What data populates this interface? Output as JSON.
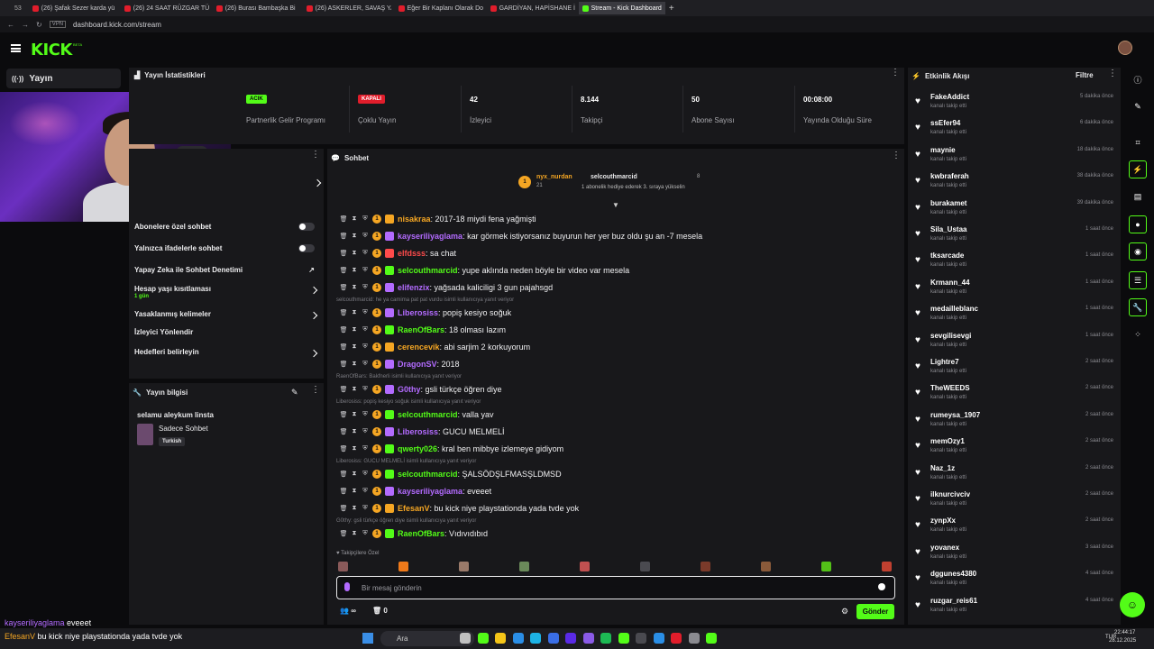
{
  "browser": {
    "tabs": [
      {
        "label": "(26) Şafak Sezer karda yü",
        "active": false
      },
      {
        "label": "(26) 24 SAAT RÜZGAR TÜ",
        "active": false
      },
      {
        "label": "(26) Burası Bambaşka Bi",
        "active": false
      },
      {
        "label": "(26) ASKERLER, SAVAŞ YA",
        "active": false
      },
      {
        "label": "Eğer Bir Kaplanı Olarak Do",
        "active": false
      },
      {
        "label": "GARDİYAN, HAPİSHANE İ",
        "active": false
      },
      {
        "label": "Stream - Kick Dashboard",
        "active": true
      }
    ],
    "tab_count": "53",
    "vpn": "VPN",
    "url": "dashboard.kick.com/stream"
  },
  "header": {
    "logo": "KICK",
    "beta": "BETA"
  },
  "nav": {
    "yayin": "Yayın"
  },
  "stats": {
    "title": "Yayın İstatistikleri",
    "items": [
      {
        "value": "ACIK",
        "label": "Partnerlik Gelir Programı",
        "kind": "green"
      },
      {
        "value": "KAPALI",
        "label": "Çoklu Yayın",
        "kind": "red"
      },
      {
        "value": "42",
        "label": "İzleyici",
        "kind": "text"
      },
      {
        "value": "8.144",
        "label": "Takipçi",
        "kind": "text"
      },
      {
        "value": "50",
        "label": "Abone Sayısı",
        "kind": "text"
      },
      {
        "value": "00:08:00",
        "label": "Yayında Olduğu Süre",
        "kind": "text"
      }
    ]
  },
  "settings": {
    "rows": [
      {
        "label": "Abonelere özel sohbet",
        "type": "toggle"
      },
      {
        "label": "Yalnızca ifadelerle sohbet",
        "type": "toggle"
      },
      {
        "label": "Yapay Zeka ile Sohbet Denetimi",
        "type": "external"
      },
      {
        "label": "Hesap yaşı kısıtlaması",
        "sub": "1 gün",
        "type": "chevron"
      },
      {
        "label": "Yasaklanmış kelimeler",
        "type": "chevron"
      },
      {
        "label": "İzleyici Yönlendir",
        "type": "none"
      },
      {
        "label": "Hedefleri belirleyin",
        "type": "chevron"
      }
    ]
  },
  "stream_info": {
    "title": "Yayın bilgisi",
    "stream_title": "selamu aleykum linsta",
    "category": "Sadece Sohbet",
    "tag": "Turkish"
  },
  "chat": {
    "title": "Sohbet",
    "pinned": {
      "gifter": "nyx_nurdan",
      "gifter_count": "21",
      "receiver": "selcouthmarcid",
      "receiver_count": "8",
      "text": "1 abonelik hediye ederek 3. sıraya yükselin"
    },
    "messages": [
      {
        "user": "nisakraa",
        "color": "#f5a623",
        "text": ": 2017-18 miydi fena yağmişti",
        "reply": ""
      },
      {
        "user": "kayseriliyaglama",
        "color": "#b36bff",
        "text": ": kar görmek istiyorsanız buyurun her yer buz oldu şu an -7 mesela",
        "reply": ""
      },
      {
        "user": "elfdsss",
        "color": "#ff4b4b",
        "text": ": sa chat",
        "reply": ""
      },
      {
        "user": "selcouthmarcid",
        "color": "#53fc18",
        "text": ": yupe aklında neden böyle bir video var mesela",
        "reply": ""
      },
      {
        "user": "elifenzix",
        "color": "#b36bff",
        "text": ": yağsada kaliciligi 3 gun pajahsgd",
        "reply": ""
      },
      {
        "user": "Liberosiss",
        "color": "#b36bff",
        "text": ": popiş kesiyo soğuk",
        "reply": "selcouthmarcid: he ya camima pat pat vurdu isimli kullanıcıya yanıt veriyor"
      },
      {
        "user": "RaenOfBars",
        "color": "#53fc18",
        "text": ": 18 olması lazım",
        "reply": ""
      },
      {
        "user": "cerencevik",
        "color": "#f5a623",
        "text": ": abi sarjim 2 korkuyorum",
        "reply": ""
      },
      {
        "user": "DragonSV",
        "color": "#b36bff",
        "text": ": 2018",
        "reply": ""
      },
      {
        "user": "G0thy",
        "color": "#b36bff",
        "text": ": gsli türkçe öğren diye",
        "reply": "RaenOfBars: Bakfnerli isimli kullanıcıya yanıt veriyor"
      },
      {
        "user": "selcouthmarcid",
        "color": "#53fc18",
        "text": ": valla yav",
        "reply": "Liberosiss: popiş kesiyo soğuk isimli kullanıcıya yanıt veriyor"
      },
      {
        "user": "Liberosiss",
        "color": "#b36bff",
        "text": ": GUCU MELMELİ",
        "reply": ""
      },
      {
        "user": "qwerty026",
        "color": "#53fc18",
        "text": ": kral ben mibbye izlemeye gidiyom",
        "reply": ""
      },
      {
        "user": "selcouthmarcid",
        "color": "#53fc18",
        "text": ": ŞALSÖDŞLFMASŞLDMSD",
        "reply": "Liberosiss: GUCU MELMELİ isimli kullanıcıya yanıt veriyor"
      },
      {
        "user": "kayseriliyaglama",
        "color": "#b36bff",
        "text": ": eveeet",
        "reply": ""
      },
      {
        "user": "EfesanV",
        "color": "#f5a623",
        "text": ": bu kick niye playstationda yada tvde yok",
        "reply": ""
      },
      {
        "user": "RaenOfBars",
        "color": "#53fc18",
        "text": ": Vıdıvıdıbıd",
        "reply": "G0thy: gsli türkçe öğren diye isimli kullanıcıya yanıt veriyor"
      }
    ],
    "followers_only": "Takipçilere Özel",
    "input_placeholder": "Bir mesaj gönderin",
    "infinity": "∞",
    "zero": "0",
    "send": "Gönder"
  },
  "activity": {
    "title": "Etkinlik Akışı",
    "filter": "Filtre",
    "items": [
      {
        "name": "FakeAddict",
        "sub": "kanalı takip etti",
        "time": "5 dakika önce"
      },
      {
        "name": "ssEfer94",
        "sub": "kanalı takip etti",
        "time": "6 dakika önce"
      },
      {
        "name": "maynie",
        "sub": "kanalı takip etti",
        "time": "18 dakika önce"
      },
      {
        "name": "kwbraferah",
        "sub": "kanalı takip etti",
        "time": "38 dakika önce"
      },
      {
        "name": "burakamet",
        "sub": "kanalı takip etti",
        "time": "39 dakika önce"
      },
      {
        "name": "Sila_Ustaa",
        "sub": "kanalı takip etti",
        "time": "1 saat önce"
      },
      {
        "name": "tksarcade",
        "sub": "kanalı takip etti",
        "time": "1 saat önce"
      },
      {
        "name": "Krmann_44",
        "sub": "kanalı takip etti",
        "time": "1 saat önce"
      },
      {
        "name": "medailleblanc",
        "sub": "kanalı takip etti",
        "time": "1 saat önce"
      },
      {
        "name": "sevgilisevgi",
        "sub": "kanalı takip etti",
        "time": "1 saat önce"
      },
      {
        "name": "Lightre7",
        "sub": "kanalı takip etti",
        "time": "2 saat önce"
      },
      {
        "name": "TheWEEDS",
        "sub": "kanalı takip etti",
        "time": "2 saat önce"
      },
      {
        "name": "rumeysa_1907",
        "sub": "kanalı takip etti",
        "time": "2 saat önce"
      },
      {
        "name": "memOzy1",
        "sub": "kanalı takip etti",
        "time": "2 saat önce"
      },
      {
        "name": "Naz_1z",
        "sub": "kanalı takip etti",
        "time": "2 saat önce"
      },
      {
        "name": "ilknurcivciv",
        "sub": "kanalı takip etti",
        "time": "2 saat önce"
      },
      {
        "name": "zynpXx",
        "sub": "kanalı takip etti",
        "time": "2 saat önce"
      },
      {
        "name": "yovanex",
        "sub": "kanalı takip etti",
        "time": "3 saat önce"
      },
      {
        "name": "dggunes4380",
        "sub": "kanalı takip etti",
        "time": "4 saat önce"
      },
      {
        "name": "ruzgar_reis61",
        "sub": "kanalı takip etti",
        "time": "4 saat önce"
      }
    ]
  },
  "overlay": {
    "line1_user": "kayseriliyaglama",
    "line1_text": "eveeet",
    "line2_user": "EfesanV",
    "line2_text": "bu kick niye playstationda yada tvde yok"
  },
  "taskbar": {
    "search": "Ara",
    "lang": "TUR",
    "time": "22:44:17",
    "date": "28.12.2025"
  }
}
